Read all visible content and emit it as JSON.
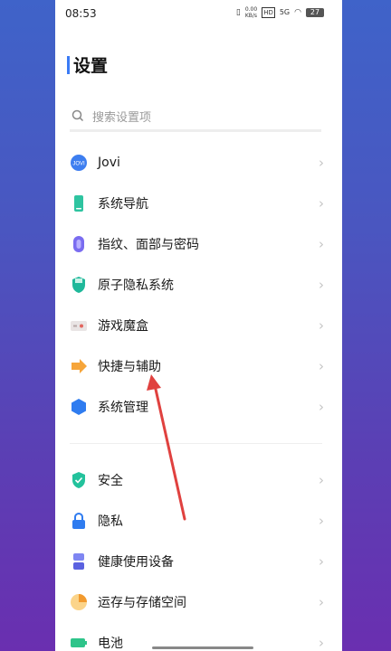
{
  "status": {
    "time": "08:53",
    "speed": "0.00 KB/s",
    "hd": "HD",
    "net": "5G",
    "battery": "27"
  },
  "page": {
    "title": "设置"
  },
  "search": {
    "placeholder": "搜索设置项"
  },
  "groups": [
    [
      {
        "label": "Jovi",
        "icon": "jovi-icon"
      },
      {
        "label": "系统导航",
        "icon": "phone-nav-icon"
      },
      {
        "label": "指纹、面部与密码",
        "icon": "fingerprint-icon"
      },
      {
        "label": "原子隐私系统",
        "icon": "shield-privacy-icon"
      },
      {
        "label": "游戏魔盒",
        "icon": "game-box-icon"
      },
      {
        "label": "快捷与辅助",
        "icon": "shortcut-arrow-icon"
      },
      {
        "label": "系统管理",
        "icon": "hexagon-icon"
      }
    ],
    [
      {
        "label": "安全",
        "icon": "security-shield-icon"
      },
      {
        "label": "隐私",
        "icon": "lock-icon"
      },
      {
        "label": "健康使用设备",
        "icon": "hourglass-icon"
      },
      {
        "label": "运存与存储空间",
        "icon": "storage-pie-icon"
      },
      {
        "label": "电池",
        "icon": "battery-icon"
      }
    ]
  ]
}
